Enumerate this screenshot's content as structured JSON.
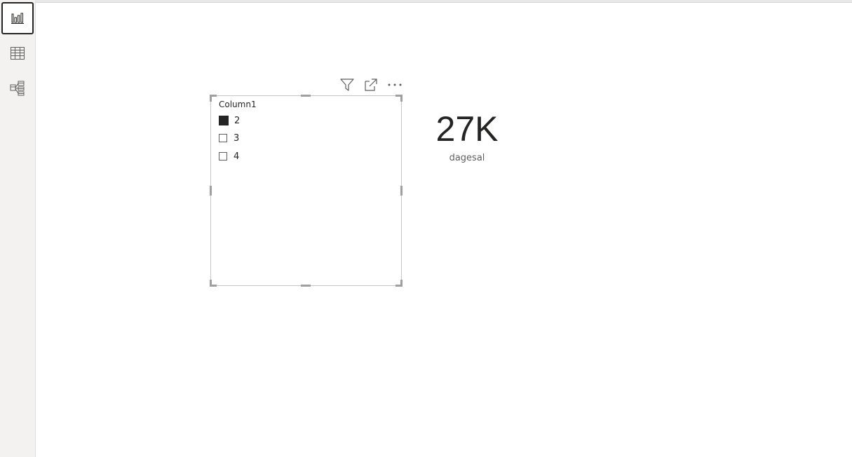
{
  "sidebar": {
    "items": [
      {
        "icon": "report-view-icon",
        "active": true
      },
      {
        "icon": "data-view-icon",
        "active": false
      },
      {
        "icon": "model-view-icon",
        "active": false
      }
    ]
  },
  "slicer": {
    "title": "Column1",
    "items": [
      {
        "label": "2",
        "checked": true
      },
      {
        "label": "3",
        "checked": false
      },
      {
        "label": "4",
        "checked": false
      }
    ],
    "header_icons": [
      "filter-icon",
      "focus-mode-icon",
      "more-options-icon"
    ]
  },
  "card": {
    "value": "27K",
    "label": "dagesal"
  },
  "colors": {
    "sidebar_bg": "#f3f2f1",
    "text": "#252423",
    "secondary_text": "#605e5c",
    "border": "#c8c6c4"
  }
}
